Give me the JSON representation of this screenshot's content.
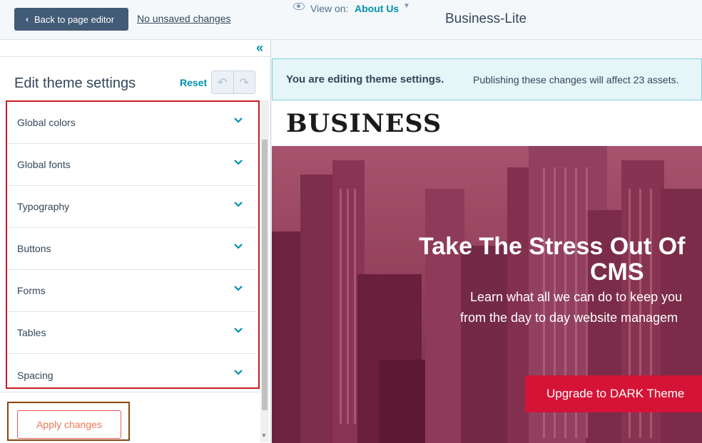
{
  "topbar": {
    "back_label": "Back to page editor",
    "unsaved_label": "No unsaved changes",
    "title": "Business-Lite"
  },
  "left_panel": {
    "collapse_icon": "double-chevron-left-icon",
    "title": "Edit theme settings",
    "reset_label": "Reset",
    "undo_icon": "undo-icon",
    "redo_icon": "redo-icon",
    "sections": [
      {
        "label": "Global colors"
      },
      {
        "label": "Global fonts"
      },
      {
        "label": "Typography"
      },
      {
        "label": "Buttons"
      },
      {
        "label": "Forms"
      },
      {
        "label": "Tables"
      },
      {
        "label": "Spacing"
      }
    ],
    "apply_label": "Apply changes"
  },
  "preview": {
    "view_on_label": "View on:",
    "view_on_value": "About Us",
    "notice_strong": "You are editing theme settings.",
    "notice_text": "Publishing these changes will affect 23 assets.",
    "logo_text": "BUSINESS",
    "hero": {
      "heading_line1": "Take The Stress Out Of",
      "heading_line2": "CMS",
      "sub_line1": "Learn what all we can do to keep you",
      "sub_line2": "from the day to day website managem",
      "button_label": "Upgrade to DARK Theme"
    }
  },
  "colors": {
    "accent": "#0091ae",
    "back_button": "#425b76",
    "highlight_box": "#c51d23",
    "hero_overlay": "#b03a5b",
    "cta": "#d51336"
  }
}
